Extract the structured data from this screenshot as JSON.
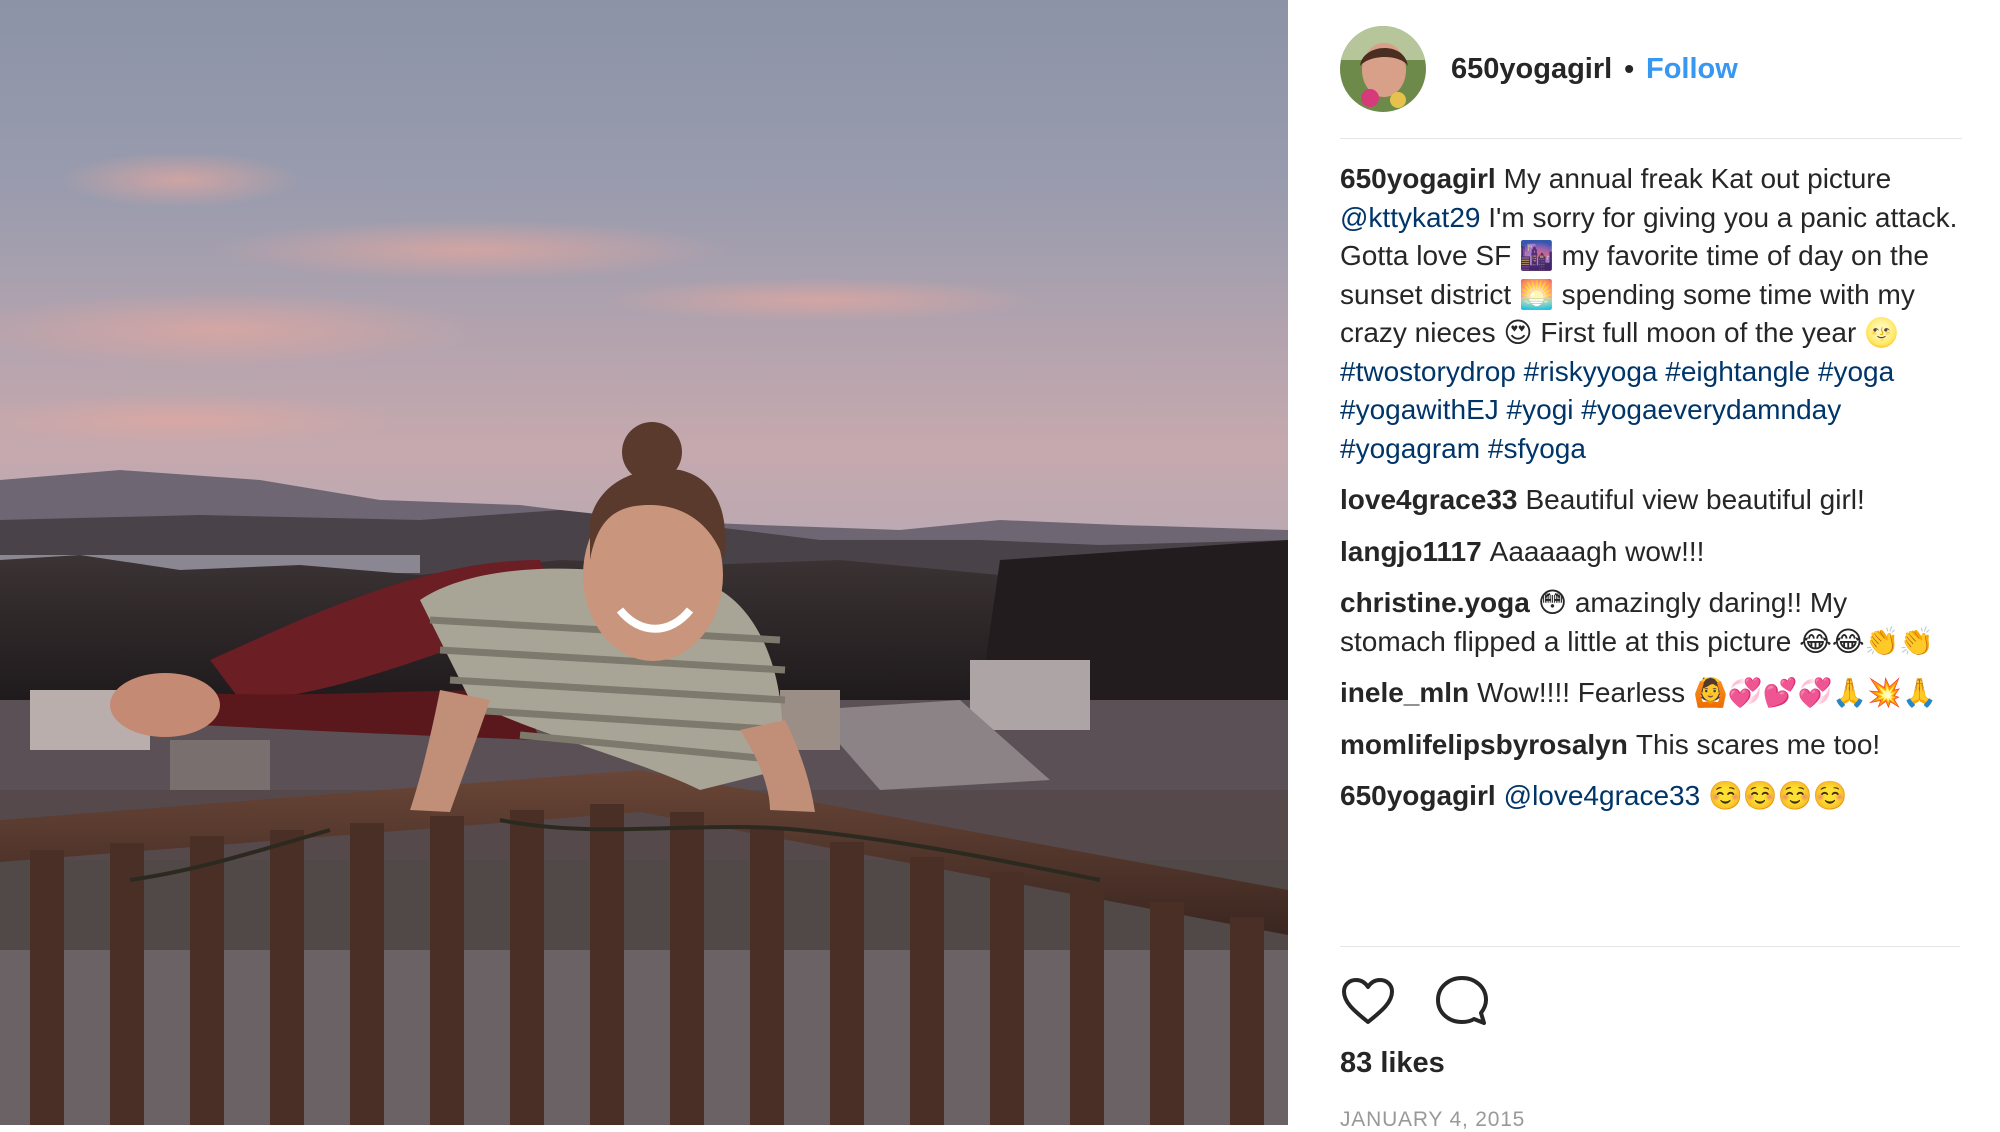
{
  "post": {
    "author": "650yogagirl",
    "separator": "•",
    "follow_label": "Follow",
    "likes": "83 likes",
    "date": "JANUARY 4, 2015"
  },
  "comments": [
    {
      "user": "650yogagirl",
      "parts": [
        {
          "type": "text",
          "value": "My annual freak Kat out picture "
        },
        {
          "type": "mention",
          "value": "@kttykat29"
        },
        {
          "type": "text",
          "value": " I'm sorry for giving you a panic attack. Gotta love SF "
        },
        {
          "type": "emoji",
          "value": "🌆"
        },
        {
          "type": "text",
          "value": "  my favorite time of day on the sunset district "
        },
        {
          "type": "emoji",
          "value": "🌅"
        },
        {
          "type": "text",
          "value": " spending some time with my crazy nieces "
        },
        {
          "type": "emoji",
          "value": "😍"
        },
        {
          "type": "text",
          "value": " First full moon of the year "
        },
        {
          "type": "emoji",
          "value": "🌝"
        },
        {
          "type": "text",
          "value": " "
        },
        {
          "type": "hashtag",
          "value": "#twostorydrop"
        },
        {
          "type": "text",
          "value": " "
        },
        {
          "type": "hashtag",
          "value": "#riskyyoga"
        },
        {
          "type": "text",
          "value": " "
        },
        {
          "type": "hashtag",
          "value": "#eightangle"
        },
        {
          "type": "text",
          "value": " "
        },
        {
          "type": "hashtag",
          "value": "#yoga"
        },
        {
          "type": "text",
          "value": " "
        },
        {
          "type": "hashtag",
          "value": "#yogawithEJ"
        },
        {
          "type": "text",
          "value": " "
        },
        {
          "type": "hashtag",
          "value": "#yogi"
        },
        {
          "type": "text",
          "value": " "
        },
        {
          "type": "hashtag",
          "value": "#yogaeverydamnday"
        },
        {
          "type": "text",
          "value": " "
        },
        {
          "type": "hashtag",
          "value": "#yogagram"
        },
        {
          "type": "text",
          "value": " "
        },
        {
          "type": "hashtag",
          "value": "#sfyoga"
        }
      ]
    },
    {
      "user": "love4grace33",
      "parts": [
        {
          "type": "text",
          "value": "Beautiful view beautiful girl!"
        }
      ]
    },
    {
      "user": "langjo1117",
      "parts": [
        {
          "type": "text",
          "value": "Aaaaaagh wow!!!"
        }
      ]
    },
    {
      "user": "christine.yoga",
      "parts": [
        {
          "type": "emoji",
          "value": "😳"
        },
        {
          "type": "text",
          "value": "  amazingly daring!! My stomach flipped a little at this picture "
        },
        {
          "type": "emoji",
          "value": "😂😂👏👏"
        }
      ]
    },
    {
      "user": "inele_mln",
      "parts": [
        {
          "type": "text",
          "value": "Wow!!!! Fearless "
        },
        {
          "type": "emoji",
          "value": "🙆💞💕💞🙏💥🙏"
        }
      ]
    },
    {
      "user": "momlifelipsbyrosalyn",
      "parts": [
        {
          "type": "text",
          "value": "This scares me too!"
        }
      ]
    },
    {
      "user": "650yogagirl",
      "parts": [
        {
          "type": "mention",
          "value": "@love4grace33"
        },
        {
          "type": "text",
          "value": " "
        },
        {
          "type": "emoji",
          "value": "☺️☺️☺️☺️"
        }
      ]
    }
  ],
  "icons": {
    "like": "heart-outline-icon",
    "comment": "speech-bubble-icon"
  },
  "colors": {
    "follow": "#3897f0",
    "link": "#003569",
    "text": "#262626",
    "muted": "#999999",
    "divider": "#e6e6e6"
  }
}
